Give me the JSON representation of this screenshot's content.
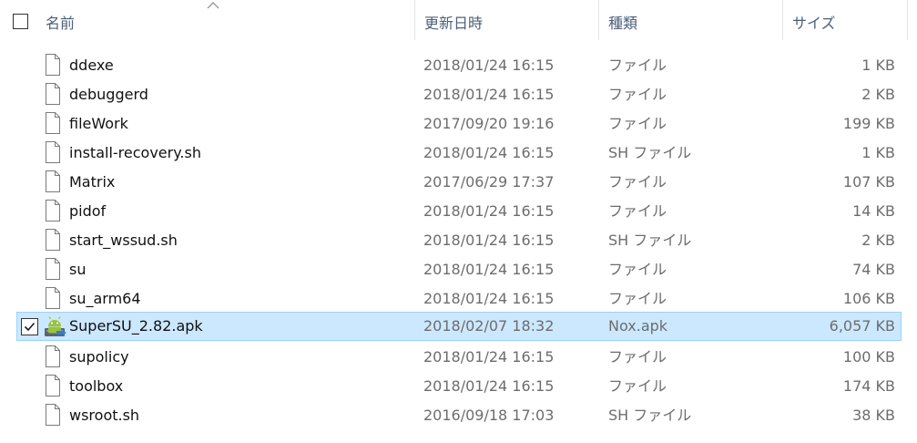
{
  "header": {
    "columns": {
      "name": "名前",
      "date": "更新日時",
      "type": "種類",
      "size": "サイズ"
    }
  },
  "files": [
    {
      "name": "ddexe",
      "date": "2018/01/24 16:15",
      "type": "ファイル",
      "size": "1 KB",
      "selected": false,
      "icon": "generic-file-icon"
    },
    {
      "name": "debuggerd",
      "date": "2018/01/24 16:15",
      "type": "ファイル",
      "size": "2 KB",
      "selected": false,
      "icon": "generic-file-icon"
    },
    {
      "name": "fileWork",
      "date": "2017/09/20 19:16",
      "type": "ファイル",
      "size": "199 KB",
      "selected": false,
      "icon": "generic-file-icon"
    },
    {
      "name": "install-recovery.sh",
      "date": "2018/01/24 16:15",
      "type": "SH ファイル",
      "size": "1 KB",
      "selected": false,
      "icon": "generic-file-icon"
    },
    {
      "name": "Matrix",
      "date": "2017/06/29 17:37",
      "type": "ファイル",
      "size": "107 KB",
      "selected": false,
      "icon": "generic-file-icon"
    },
    {
      "name": "pidof",
      "date": "2018/01/24 16:15",
      "type": "ファイル",
      "size": "14 KB",
      "selected": false,
      "icon": "generic-file-icon"
    },
    {
      "name": "start_wssud.sh",
      "date": "2018/01/24 16:15",
      "type": "SH ファイル",
      "size": "2 KB",
      "selected": false,
      "icon": "generic-file-icon"
    },
    {
      "name": "su",
      "date": "2018/01/24 16:15",
      "type": "ファイル",
      "size": "74 KB",
      "selected": false,
      "icon": "generic-file-icon"
    },
    {
      "name": "su_arm64",
      "date": "2018/01/24 16:15",
      "type": "ファイル",
      "size": "106 KB",
      "selected": false,
      "icon": "generic-file-icon"
    },
    {
      "name": "SuperSU_2.82.apk",
      "date": "2018/02/07 18:32",
      "type": "Nox.apk",
      "size": "6,057 KB",
      "selected": true,
      "icon": "android-apk-icon"
    },
    {
      "name": "supolicy",
      "date": "2018/01/24 16:15",
      "type": "ファイル",
      "size": "100 KB",
      "selected": false,
      "icon": "generic-file-icon"
    },
    {
      "name": "toolbox",
      "date": "2018/01/24 16:15",
      "type": "ファイル",
      "size": "174 KB",
      "selected": false,
      "icon": "generic-file-icon"
    },
    {
      "name": "wsroot.sh",
      "date": "2016/09/18 17:03",
      "type": "SH ファイル",
      "size": "38 KB",
      "selected": false,
      "icon": "generic-file-icon"
    }
  ],
  "colors": {
    "selection_bg": "#cce8ff",
    "selection_border": "#99d1ff",
    "header_text": "#4c607a",
    "detail_text": "#6d6d6d"
  }
}
